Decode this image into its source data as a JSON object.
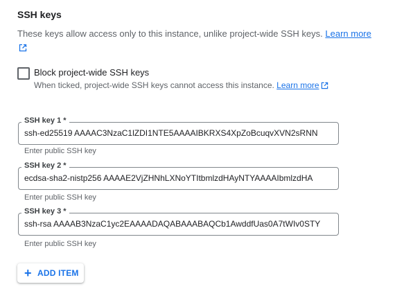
{
  "section": {
    "title": "SSH keys",
    "description": "These keys allow access only to this instance, unlike project-wide SSH keys.",
    "learn_more": "Learn more"
  },
  "block_keys": {
    "checked": false,
    "label": "Block project-wide SSH keys",
    "hint": "When ticked, project-wide SSH keys cannot access this instance.",
    "learn_more": "Learn more"
  },
  "ssh_keys": [
    {
      "label": "SSH key 1 *",
      "value": "ssh-ed25519 AAAAC3NzaC1lZDI1NTE5AAAAIBKRXS4XpZoBcuqvXVN2sRNN",
      "helper": "Enter public SSH key"
    },
    {
      "label": "SSH key 2 *",
      "value": "ecdsa-sha2-nistp256 AAAAE2VjZHNhLXNoYTItbmlzdHAyNTYAAAAIbmlzdHA",
      "helper": "Enter public SSH key"
    },
    {
      "label": "SSH key 3 *",
      "value": "ssh-rsa AAAAB3NzaC1yc2EAAAADAQABAAABAQCb1AwddfUas0A7tWIv0STY",
      "helper": "Enter public SSH key"
    }
  ],
  "add_item": {
    "label": "ADD ITEM",
    "icon": "plus-icon"
  },
  "colors": {
    "accent": "#1a73e8",
    "text": "#202124",
    "secondary_text": "#5f6368"
  }
}
